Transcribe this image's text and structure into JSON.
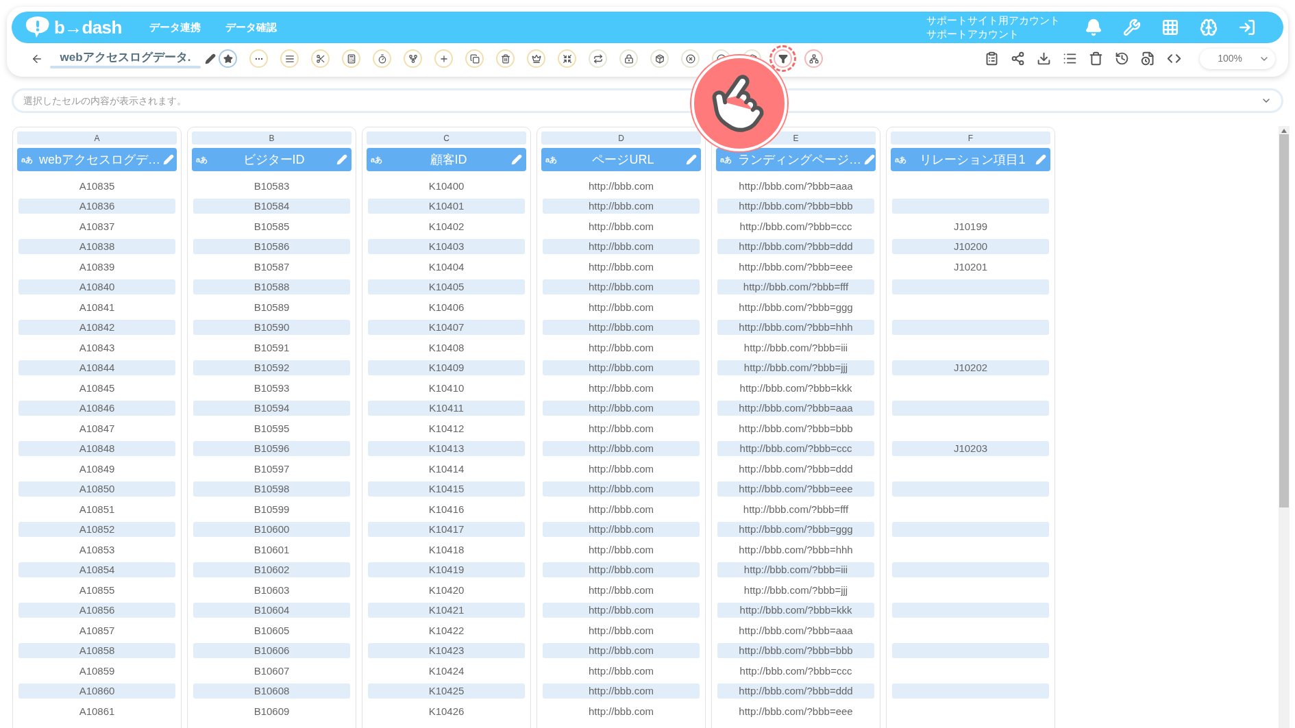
{
  "header": {
    "logo_text": "b→dash",
    "nav": [
      "データ連携",
      "データ確認"
    ],
    "account": [
      "サポートサイト用アカウント",
      "サポートアカウント"
    ]
  },
  "toolbar": {
    "title": "webアクセスログデータ.",
    "tools": [
      {
        "color": "#a9c8e8",
        "highlighted": false
      },
      {
        "color": "#f3dfae",
        "highlighted": false
      },
      {
        "color": "#f3dfae",
        "highlighted": false
      },
      {
        "color": "#f3dfae",
        "highlighted": false
      },
      {
        "color": "#f3dfae",
        "highlighted": false
      },
      {
        "color": "#f3dfae",
        "highlighted": false
      },
      {
        "color": "#f3dfae",
        "highlighted": false
      },
      {
        "color": "#f3dfae",
        "highlighted": false
      },
      {
        "color": "#f3dfae",
        "highlighted": false
      },
      {
        "color": "#f3dfae",
        "highlighted": false
      },
      {
        "color": "#f3dfae",
        "highlighted": false
      },
      {
        "color": "#f3dfae",
        "highlighted": false
      },
      {
        "color": "#e3e8d4",
        "highlighted": false
      },
      {
        "color": "#e3e8d4",
        "highlighted": false
      },
      {
        "color": "#e3e8d4",
        "highlighted": false
      },
      {
        "color": "#e3e8d4",
        "highlighted": false
      },
      {
        "color": "#e3e8d4",
        "highlighted": false
      },
      {
        "color": "#e3e8d4",
        "highlighted": false
      },
      {
        "color": "#f5b8b8",
        "highlighted": true
      },
      {
        "color": "#f5b8b8",
        "highlighted": false
      }
    ],
    "zoom": "100%"
  },
  "formula_bar": {
    "placeholder": "選択したセルの内容が表示されます。"
  },
  "columns": [
    {
      "letter": "A",
      "type_label": "aあ",
      "name": "webアクセスログデ…"
    },
    {
      "letter": "B",
      "type_label": "aあ",
      "name": "ビジターID"
    },
    {
      "letter": "C",
      "type_label": "aあ",
      "name": "顧客ID"
    },
    {
      "letter": "D",
      "type_label": "aあ",
      "name": "ページURL"
    },
    {
      "letter": "E",
      "type_label": "aあ",
      "name": "ランディングページ…"
    },
    {
      "letter": "F",
      "type_label": "aあ",
      "name": "リレーション項目1"
    }
  ],
  "rows": [
    {
      "cells": [
        "A10835",
        "B10583",
        "K10400",
        "http://bbb.com",
        "http://bbb.com/?bbb=aaa",
        null
      ]
    },
    {
      "cells": [
        "A10836",
        "B10584",
        "K10401",
        "http://bbb.com",
        "http://bbb.com/?bbb=bbb",
        null
      ]
    },
    {
      "cells": [
        "A10837",
        "B10585",
        "K10402",
        "http://bbb.com",
        "http://bbb.com/?bbb=ccc",
        "J10199"
      ]
    },
    {
      "cells": [
        "A10838",
        "B10586",
        "K10403",
        "http://bbb.com",
        "http://bbb.com/?bbb=ddd",
        "J10200"
      ]
    },
    {
      "cells": [
        "A10839",
        "B10587",
        "K10404",
        "http://bbb.com",
        "http://bbb.com/?bbb=eee",
        "J10201"
      ]
    },
    {
      "cells": [
        "A10840",
        "B10588",
        "K10405",
        "http://bbb.com",
        "http://bbb.com/?bbb=fff",
        null
      ]
    },
    {
      "cells": [
        "A10841",
        "B10589",
        "K10406",
        "http://bbb.com",
        "http://bbb.com/?bbb=ggg",
        null
      ]
    },
    {
      "cells": [
        "A10842",
        "B10590",
        "K10407",
        "http://bbb.com",
        "http://bbb.com/?bbb=hhh",
        null
      ]
    },
    {
      "cells": [
        "A10843",
        "B10591",
        "K10408",
        "http://bbb.com",
        "http://bbb.com/?bbb=iii",
        null
      ]
    },
    {
      "cells": [
        "A10844",
        "B10592",
        "K10409",
        "http://bbb.com",
        "http://bbb.com/?bbb=jjj",
        "J10202"
      ]
    },
    {
      "cells": [
        "A10845",
        "B10593",
        "K10410",
        "http://bbb.com",
        "http://bbb.com/?bbb=kkk",
        null
      ]
    },
    {
      "cells": [
        "A10846",
        "B10594",
        "K10411",
        "http://bbb.com",
        "http://bbb.com/?bbb=aaa",
        null
      ]
    },
    {
      "cells": [
        "A10847",
        "B10595",
        "K10412",
        "http://bbb.com",
        "http://bbb.com/?bbb=bbb",
        null
      ]
    },
    {
      "cells": [
        "A10848",
        "B10596",
        "K10413",
        "http://bbb.com",
        "http://bbb.com/?bbb=ccc",
        "J10203"
      ]
    },
    {
      "cells": [
        "A10849",
        "B10597",
        "K10414",
        "http://bbb.com",
        "http://bbb.com/?bbb=ddd",
        null
      ]
    },
    {
      "cells": [
        "A10850",
        "B10598",
        "K10415",
        "http://bbb.com",
        "http://bbb.com/?bbb=eee",
        null
      ]
    },
    {
      "cells": [
        "A10851",
        "B10599",
        "K10416",
        "http://bbb.com",
        "http://bbb.com/?bbb=fff",
        null
      ]
    },
    {
      "cells": [
        "A10852",
        "B10600",
        "K10417",
        "http://bbb.com",
        "http://bbb.com/?bbb=ggg",
        null
      ]
    },
    {
      "cells": [
        "A10853",
        "B10601",
        "K10418",
        "http://bbb.com",
        "http://bbb.com/?bbb=hhh",
        null
      ]
    },
    {
      "cells": [
        "A10854",
        "B10602",
        "K10419",
        "http://bbb.com",
        "http://bbb.com/?bbb=iii",
        null
      ]
    },
    {
      "cells": [
        "A10855",
        "B10603",
        "K10420",
        "http://bbb.com",
        "http://bbb.com/?bbb=jjj",
        null
      ]
    },
    {
      "cells": [
        "A10856",
        "B10604",
        "K10421",
        "http://bbb.com",
        "http://bbb.com/?bbb=kkk",
        null
      ]
    },
    {
      "cells": [
        "A10857",
        "B10605",
        "K10422",
        "http://bbb.com",
        "http://bbb.com/?bbb=aaa",
        null
      ]
    },
    {
      "cells": [
        "A10858",
        "B10606",
        "K10423",
        "http://bbb.com",
        "http://bbb.com/?bbb=bbb",
        null
      ]
    },
    {
      "cells": [
        "A10859",
        "B10607",
        "K10424",
        "http://bbb.com",
        "http://bbb.com/?bbb=ccc",
        null
      ]
    },
    {
      "cells": [
        "A10860",
        "B10608",
        "K10425",
        "http://bbb.com",
        "http://bbb.com/?bbb=ddd",
        null
      ]
    },
    {
      "cells": [
        "A10861",
        "B10609",
        "K10426",
        "http://bbb.com",
        "http://bbb.com/?bbb=eee",
        null
      ]
    }
  ]
}
